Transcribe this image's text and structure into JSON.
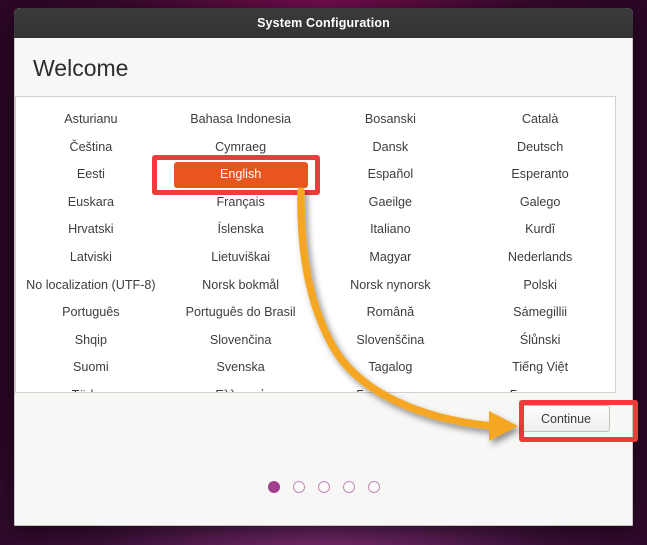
{
  "window": {
    "title": "System Configuration",
    "page_heading": "Welcome"
  },
  "language_list": {
    "selected": "English",
    "columns": 4,
    "items": [
      "Asturianu",
      "Bahasa Indonesia",
      "Bosanski",
      "Català",
      "Čeština",
      "Cymraeg",
      "Dansk",
      "Deutsch",
      "Eesti",
      "English",
      "Español",
      "Esperanto",
      "Euskara",
      "Français",
      "Gaeilge",
      "Galego",
      "Hrvatski",
      "Íslenska",
      "Italiano",
      "Kurdî",
      "Latviski",
      "Lietuviškai",
      "Magyar",
      "Nederlands",
      "No localization (UTF-8)",
      "Norsk bokmål",
      "Norsk nynorsk",
      "Polski",
      "Português",
      "Português do Brasil",
      "Română",
      "Sámegillii",
      "Shqip",
      "Slovenčina",
      "Slovenščina",
      "Ślůnski",
      "Suomi",
      "Svenska",
      "Tagalog",
      "Tiếng Việt",
      "Türkçe",
      "Ελληνικά",
      "Беларуская",
      "Български"
    ]
  },
  "footer": {
    "continue_label": "Continue",
    "pager": {
      "total": 5,
      "active_index": 1
    }
  },
  "annotations": {
    "highlight_color": "#ef3b3b",
    "arrow_color": "#f5a623",
    "accent_orange": "#e8551f",
    "boxes": [
      {
        "name": "english-option",
        "label": "English"
      },
      {
        "name": "continue-button",
        "label": "Continue"
      }
    ],
    "arrow": {
      "from": "english-option",
      "to": "continue-button"
    }
  }
}
